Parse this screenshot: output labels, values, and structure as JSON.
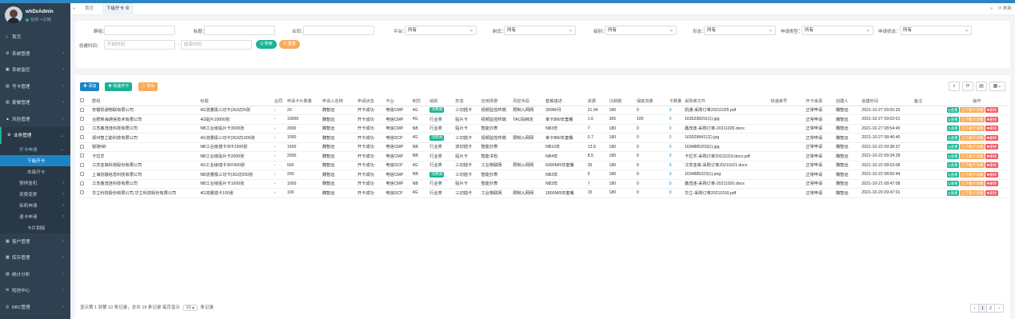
{
  "user": {
    "name": "whDxAdmin",
    "online": "在线",
    "logout": "注销"
  },
  "nav": [
    {
      "label": "首页",
      "icon": "home-icon",
      "glyph": "⌂"
    },
    {
      "label": "系统管理",
      "icon": "gear-icon",
      "glyph": "⚙"
    },
    {
      "label": "系统监控",
      "icon": "monitor-icon",
      "glyph": "▣"
    },
    {
      "label": "号卡管理",
      "icon": "card-icon",
      "glyph": "▤"
    },
    {
      "label": "套餐管理",
      "icon": "chart-icon",
      "glyph": "▥"
    },
    {
      "label": "风险管理",
      "icon": "warning-icon",
      "glyph": "▲"
    },
    {
      "label": "业务管理",
      "icon": "gears-icon",
      "glyph": "⚙"
    }
  ],
  "subnav": [
    "开卡申请",
    "下级开卡",
    "本级开卡",
    "预停复机",
    "资费变更",
    "拆机申请",
    "退卡申请",
    "卡片割接"
  ],
  "nav_bottom": [
    {
      "label": "客户管理",
      "icon": "contacts-icon",
      "glyph": "▦"
    },
    {
      "label": "库存管理",
      "icon": "inventory-icon",
      "glyph": "▩"
    },
    {
      "label": "统计分析",
      "icon": "stats-icon",
      "glyph": "▧"
    },
    {
      "label": "短信中心",
      "icon": "sms-icon",
      "glyph": "✉"
    },
    {
      "label": "BBC管理",
      "icon": "bbc-icon",
      "glyph": "◎"
    }
  ],
  "tabs": {
    "home": "首页",
    "active": "下级开卡 ⊗",
    "refresh": "⟳ 刷新"
  },
  "filter": {
    "group_label": "群组：",
    "title_label": "标题：",
    "contract_label": "合同：",
    "platform_label": "平台：",
    "format_label": "制式：",
    "level_label": "级别：",
    "form_label": "形态：",
    "apply_type_label": "申请类型：",
    "apply_status_label": "申请状态：",
    "all": "所有",
    "created_label": "创建时间：",
    "start_placeholder": "开始时间",
    "end_placeholder": "结束时间",
    "search_btn": "Q 搜索",
    "reset_btn": "⟳ 重置"
  },
  "toolbar": {
    "add": "✚ 添加",
    "quick": "✚ 快速开卡",
    "export": "⇩ 导出"
  },
  "table": {
    "headers": [
      "群组",
      "标题",
      "合同",
      "申请卡片数量",
      "申请人名称",
      "申请状态",
      "平台",
      "制式",
      "级别",
      "形态",
      "应用场景",
      "风控手段",
      "套餐描述",
      "资费",
      "沉默期",
      "保底流量",
      "卡数量",
      "采购单文件",
      "快递单号",
      "开卡来源",
      "创建人",
      "创建时间",
      "备注",
      "操作"
    ],
    "rows": [
      [
        "安徽凯通物联有限公司",
        "4G流量极三切卡(3G切20张",
        "-",
        "20",
        "魏智远",
        "开卡成功",
        "电信CMP",
        "4G",
        "消费类",
        "三切插卡",
        "视频监控终端",
        "限制入网网",
        "300M/月",
        "21.04",
        "180",
        "0",
        "0",
        "凯通-采购订单20211025.pdf",
        "",
        "正常申请",
        "魏智远",
        "2021-10-27 09:05:26",
        ""
      ],
      [
        "合肥移海通信技术有限公司",
        "4G贴片10000张",
        "-",
        "10000",
        "魏智远",
        "开卡成功",
        "电信CMP",
        "4G",
        "行业类",
        "贴片卡",
        "视频监控终端",
        "TAC码绑定",
        "单卡8M/年套餐",
        "1.6",
        "365",
        "100",
        "0",
        "1635298291(1).jpg",
        "",
        "正常申请",
        "魏智远",
        "2021-10-27 09:02:01",
        ""
      ],
      [
        "江苏鑫茂连科技有限公司",
        "NB工业级贴片卡3000张",
        "-",
        "3000",
        "魏智远",
        "开卡成功",
        "电信CMP",
        "NB",
        "行业类",
        "贴片卡",
        "智能抄表",
        "",
        "NB3年",
        "7",
        "180",
        "0",
        "0",
        "鑫茂连-采购订单-20211026.docx",
        "",
        "正常申请",
        "魏智远",
        "2021-10-27 08:54:45",
        ""
      ],
      [
        "郑州智之能科技有限公司",
        "4G流量极三切卡(3G切1000张",
        "-",
        "1000",
        "魏智远",
        "开卡成功",
        "电信DCP",
        "4G",
        "消费类",
        "三切插卡",
        "视频监控终端",
        "限制入网网",
        "单卡8M/年套餐",
        "0.7",
        "180",
        "0",
        "0",
        "1635298411(1).jpg",
        "",
        "正常申请",
        "魏智远",
        "2021-10-27 08:46:40",
        ""
      ],
      [
        "锐驰NB",
        "NB工业级插卡3FF1500张",
        "-",
        "1500",
        "魏智远",
        "开卡成功",
        "电信CMP",
        "NB",
        "行业类",
        "双切插卡",
        "智能抄表",
        "",
        "NB10年",
        "13.8",
        "180",
        "0",
        "0",
        "1634885203(1).jpg",
        "",
        "正常申请",
        "魏智远",
        "2021-10-22 09:38:37",
        ""
      ],
      [
        "卡拉羊",
        "NB工业级贴片卡2000张",
        "-",
        "2000",
        "魏智远",
        "开卡成功",
        "电信CMP",
        "NB",
        "行业类",
        "贴片卡",
        "智能书包",
        "",
        "NB4年",
        "8.5",
        "180",
        "0",
        "0",
        "卡拉羊-采购订单20211019.docx.pdf",
        "",
        "正常申请",
        "魏智远",
        "2021-10-22 09:34:28",
        ""
      ],
      [
        "江苏亚高科技股份有限公司",
        "4G工业级插卡3FF500张",
        "-",
        "500",
        "魏智远",
        "开卡成功",
        "电信DCP",
        "4G",
        "行业类",
        "三切插卡",
        "工业物联网",
        "限制入网网",
        "6000M/5年套餐",
        "35",
        "180",
        "0",
        "0",
        "江苏亚高-采购订单20211021.docx",
        "",
        "正常申请",
        "魏智远",
        "2021-10-22 08:53:08",
        ""
      ],
      [
        "上海协融信息科技有限公司",
        "NB流量极三切卡(3G切200张",
        "-",
        "200",
        "魏智远",
        "开卡成功",
        "电信CMP",
        "NB",
        "消费类",
        "三切插卡",
        "智能抄表",
        "",
        "NB3年",
        "5",
        "180",
        "0",
        "0",
        "1634885323(1).png",
        "",
        "正常申请",
        "魏智远",
        "2021-10-22 08:50:44",
        ""
      ],
      [
        "江苏鑫茂连科技有限公司",
        "NB工业级贴片卡1000张",
        "-",
        "1000",
        "魏智远",
        "开卡成功",
        "电信CMP",
        "NB",
        "行业类",
        "贴片卡",
        "智能抄表",
        "",
        "NB3年",
        "7",
        "180",
        "0",
        "0",
        "鑫茂连-采购订单-20211020.docx",
        "",
        "正常申请",
        "魏智远",
        "2021-10-21 08:47:08",
        ""
      ],
      [
        "华立科技股份有限公司,华立科技股份有限公司",
        "4G流量插卡100张",
        "-",
        "100",
        "魏智远",
        "开卡成功",
        "电信DCP",
        "4G",
        "行业类",
        "三切插卡",
        "工业物联网",
        "限制入网网",
        "1800M/5年套餐",
        "15",
        "180",
        "0",
        "0",
        "华立-采购订单20211019.pdf",
        "",
        "正常申请",
        "魏智远",
        "2021-10-20 09:47:01",
        ""
      ]
    ],
    "actions": {
      "view": "Q查看",
      "detail": "⚠下载卡详情",
      "delete": "✖删除"
    }
  },
  "pager": {
    "text_before": "显示第 1 到第 10 条记录，总共 19 条记录 每页显示",
    "page_size": "10 ▴",
    "text_after": "条记录",
    "prev": "‹",
    "p1": "1",
    "p2": "2",
    "next": "›"
  },
  "colors": {
    "sidebar": "#2f4050",
    "primary": "#1c84c6",
    "green": "#1ab394",
    "orange": "#f8ac59",
    "red": "#ed5565"
  }
}
